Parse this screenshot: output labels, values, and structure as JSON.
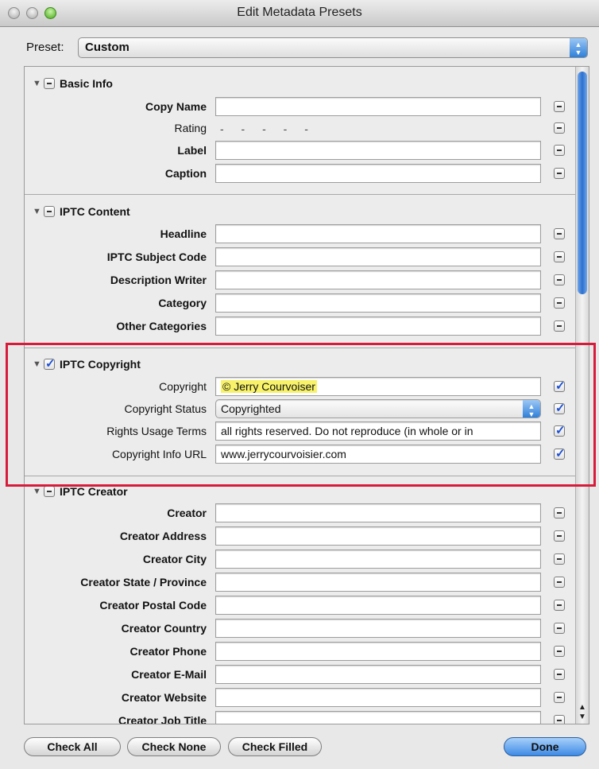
{
  "window": {
    "title": "Edit Metadata Presets"
  },
  "preset": {
    "label": "Preset:",
    "value": "Custom"
  },
  "sections": {
    "basic_info": {
      "title": "Basic Info",
      "rows": [
        {
          "label": "Copy Name",
          "value": ""
        },
        {
          "label": "Rating",
          "value": "- - - - -"
        },
        {
          "label": "Label",
          "value": ""
        },
        {
          "label": "Caption",
          "value": ""
        }
      ]
    },
    "iptc_content": {
      "title": "IPTC Content",
      "rows": [
        {
          "label": "Headline",
          "value": ""
        },
        {
          "label": "IPTC Subject Code",
          "value": ""
        },
        {
          "label": "Description Writer",
          "value": ""
        },
        {
          "label": "Category",
          "value": ""
        },
        {
          "label": "Other Categories",
          "value": ""
        }
      ]
    },
    "iptc_copyright": {
      "title": "IPTC Copyright",
      "rows": [
        {
          "label": "Copyright",
          "value": "© Jerry Courvoiser"
        },
        {
          "label": "Copyright Status",
          "value": "Copyrighted"
        },
        {
          "label": "Rights Usage Terms",
          "value": "all rights reserved. Do not reproduce (in whole or in"
        },
        {
          "label": "Copyright Info URL",
          "value": "www.jerrycourvoisier.com"
        }
      ]
    },
    "iptc_creator": {
      "title": "IPTC Creator",
      "rows": [
        {
          "label": "Creator",
          "value": ""
        },
        {
          "label": "Creator Address",
          "value": ""
        },
        {
          "label": "Creator City",
          "value": ""
        },
        {
          "label": "Creator State / Province",
          "value": ""
        },
        {
          "label": "Creator Postal Code",
          "value": ""
        },
        {
          "label": "Creator Country",
          "value": ""
        },
        {
          "label": "Creator Phone",
          "value": ""
        },
        {
          "label": "Creator E-Mail",
          "value": ""
        },
        {
          "label": "Creator Website",
          "value": ""
        },
        {
          "label": "Creator Job Title",
          "value": ""
        }
      ]
    }
  },
  "buttons": {
    "check_all": "Check All",
    "check_none": "Check None",
    "check_filled": "Check Filled",
    "done": "Done"
  },
  "colors": {
    "highlight_box": "#d61c3a",
    "text_highlight": "#f7f26a",
    "accent_blue": "#3e8ae4"
  }
}
